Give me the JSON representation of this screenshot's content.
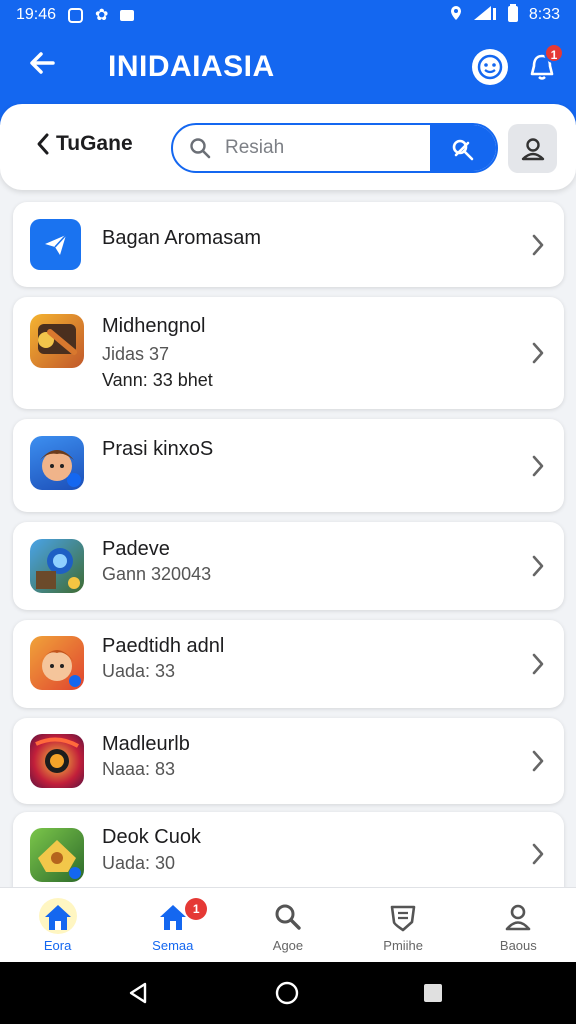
{
  "status_bar": {
    "time": "19:46",
    "right_time": "8:33"
  },
  "app_bar": {
    "title": "INIDAIASIA",
    "notification_count": "1"
  },
  "subheader": {
    "back_label": "TuGane",
    "search_placeholder": "Resiah"
  },
  "items": [
    {
      "title": "Bagan Aromasam",
      "line1": "",
      "line2": "",
      "icon": "paper-plane-icon"
    },
    {
      "title": "Midhengnol",
      "line1": "Jidas 37",
      "line2": "Vann: 33 bhet",
      "icon": "game-thumbnail"
    },
    {
      "title": "Prasi kinxoS",
      "line1": "",
      "line2": "",
      "icon": "game-thumbnail"
    },
    {
      "title": "Padeve",
      "line1": "Gann 320043",
      "line2": "",
      "icon": "game-thumbnail"
    },
    {
      "title": "Paedtidh adnl",
      "line1": "Uada: 33",
      "line2": "",
      "icon": "game-thumbnail"
    },
    {
      "title": "Madleurlb",
      "line1": "Naaa: 83",
      "line2": "",
      "icon": "game-thumbnail"
    },
    {
      "title": "Deok Cuok",
      "line1": "Uada: 30",
      "line2": "",
      "icon": "game-thumbnail"
    }
  ],
  "bottom_nav": [
    {
      "label": "Eora",
      "icon": "home-icon",
      "active": true
    },
    {
      "label": "Semaa",
      "icon": "home-icon",
      "badge": "1"
    },
    {
      "label": "Agoe",
      "icon": "search-icon"
    },
    {
      "label": "Pmiihe",
      "icon": "shield-icon"
    },
    {
      "label": "Baous",
      "icon": "person-icon"
    }
  ],
  "colors": {
    "primary": "#1467f0",
    "badge": "#e53935",
    "background": "#f1f3f6"
  }
}
